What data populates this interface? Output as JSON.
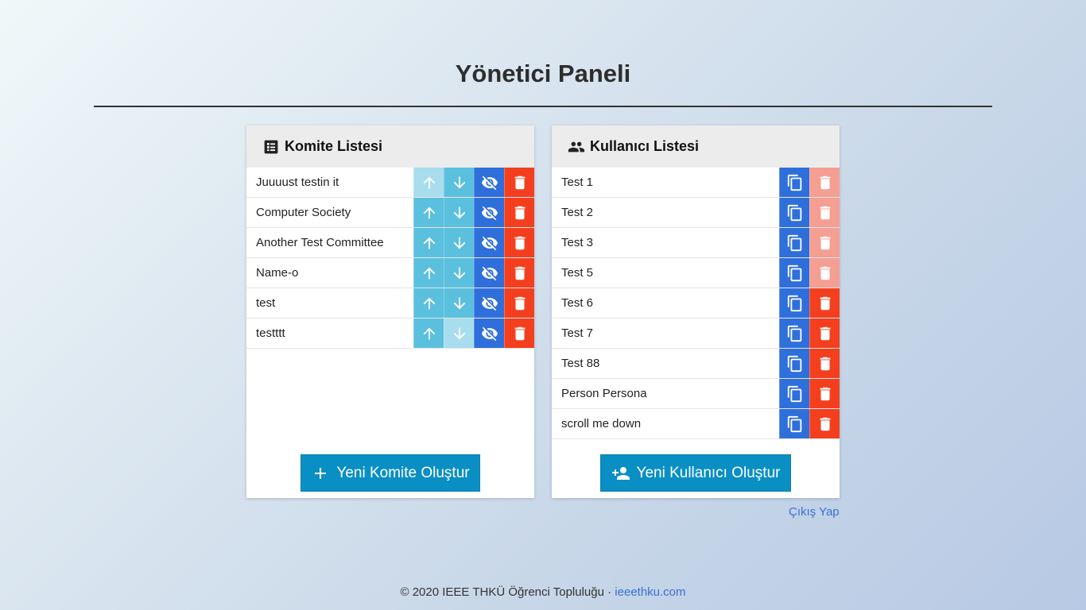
{
  "page": {
    "title": "Yönetici Paneli"
  },
  "committees": {
    "header": "Komite Listesi",
    "header_icon": "list-alt-icon",
    "items": [
      {
        "label": "Juuuust testin it",
        "up_disabled": true,
        "down_disabled": false
      },
      {
        "label": "Computer Society",
        "up_disabled": false,
        "down_disabled": false
      },
      {
        "label": "Another Test Committee",
        "up_disabled": false,
        "down_disabled": false
      },
      {
        "label": "Name-o",
        "up_disabled": false,
        "down_disabled": false
      },
      {
        "label": "test",
        "up_disabled": false,
        "down_disabled": false
      },
      {
        "label": "testttt",
        "up_disabled": false,
        "down_disabled": true
      }
    ],
    "create_label": "Yeni Komite Oluştur"
  },
  "users": {
    "header": "Kullanıcı Listesi",
    "header_icon": "people-icon",
    "items": [
      {
        "label": "Test 1",
        "delete_disabled": true
      },
      {
        "label": "Test 2",
        "delete_disabled": true
      },
      {
        "label": "Test 3",
        "delete_disabled": true
      },
      {
        "label": "Test 5",
        "delete_disabled": true
      },
      {
        "label": "Test 6",
        "delete_disabled": false
      },
      {
        "label": "Test 7",
        "delete_disabled": false
      },
      {
        "label": "Test 88",
        "delete_disabled": false
      },
      {
        "label": "Person Persona",
        "delete_disabled": false
      },
      {
        "label": "scroll me down",
        "delete_disabled": false
      }
    ],
    "create_label": "Yeni Kullanıcı Oluştur"
  },
  "logout_label": "Çıkış Yap",
  "footer": {
    "text": "© 2020 IEEE THKÜ Öğrenci Topluluğu ·",
    "link": "ieeethku.com"
  },
  "colors": {
    "info": "#5bc0de",
    "primary": "#2f6fdc",
    "danger": "#f43f1f",
    "create": "#0a8fc4"
  }
}
